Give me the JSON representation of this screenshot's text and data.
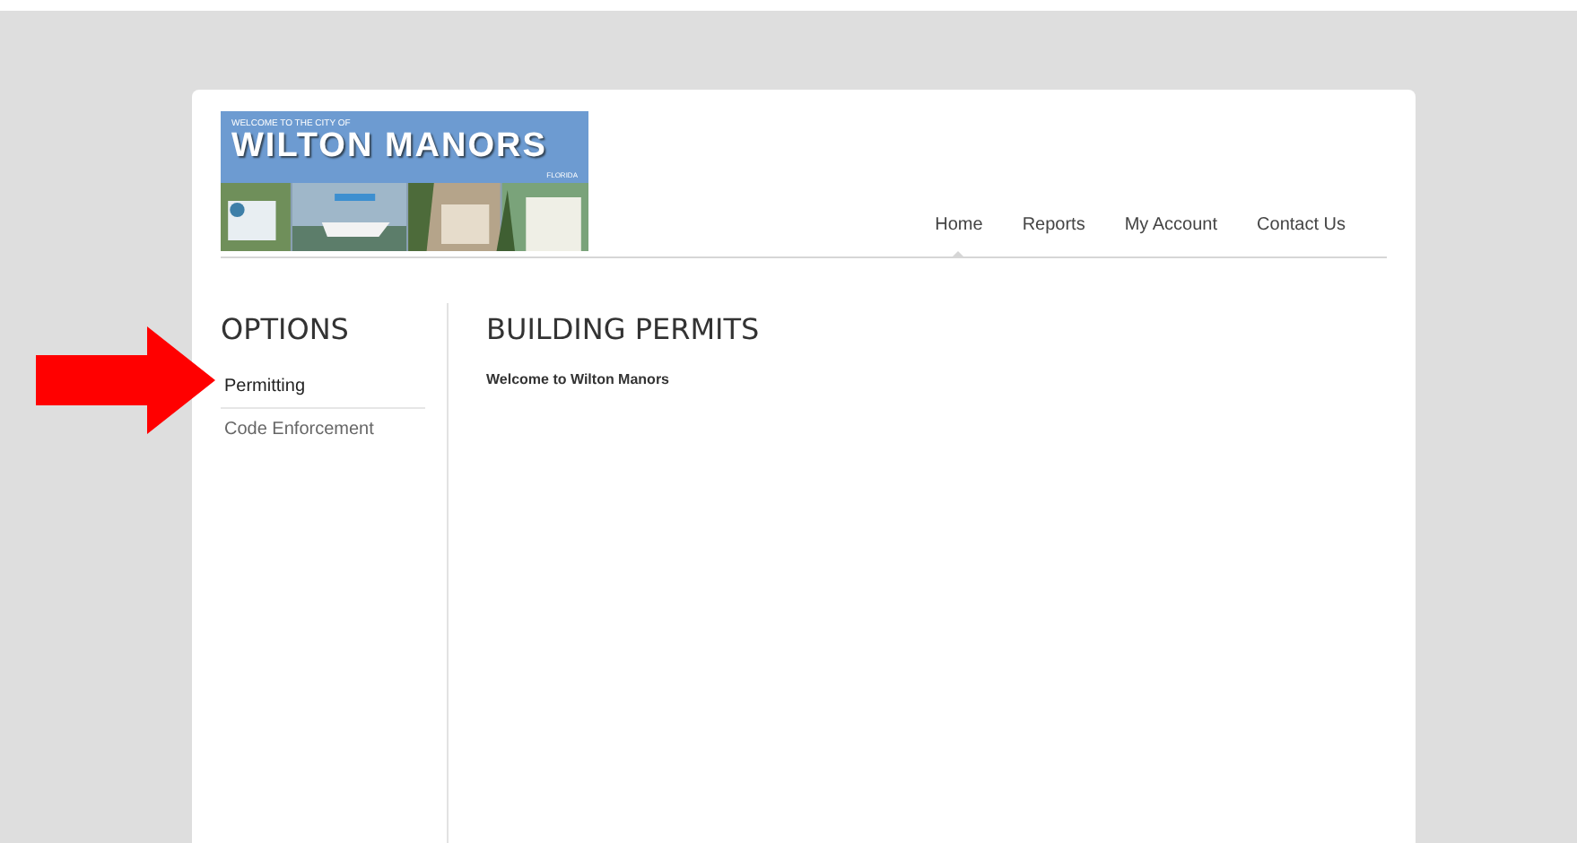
{
  "logo": {
    "welcome": "WELCOME TO THE CITY OF",
    "name": "WILTON MANORS",
    "state": "FLORIDA"
  },
  "nav": [
    {
      "label": "Home",
      "selected": true
    },
    {
      "label": "Reports",
      "selected": false
    },
    {
      "label": "My Account",
      "selected": false
    },
    {
      "label": "Contact Us",
      "selected": false
    }
  ],
  "sidebar": {
    "title": "OPTIONS",
    "items": [
      {
        "label": "Permitting",
        "selected": true
      },
      {
        "label": "Code Enforcement",
        "selected": false
      }
    ]
  },
  "main": {
    "title": "BUILDING PERMITS",
    "text": "Welcome to Wilton Manors"
  }
}
